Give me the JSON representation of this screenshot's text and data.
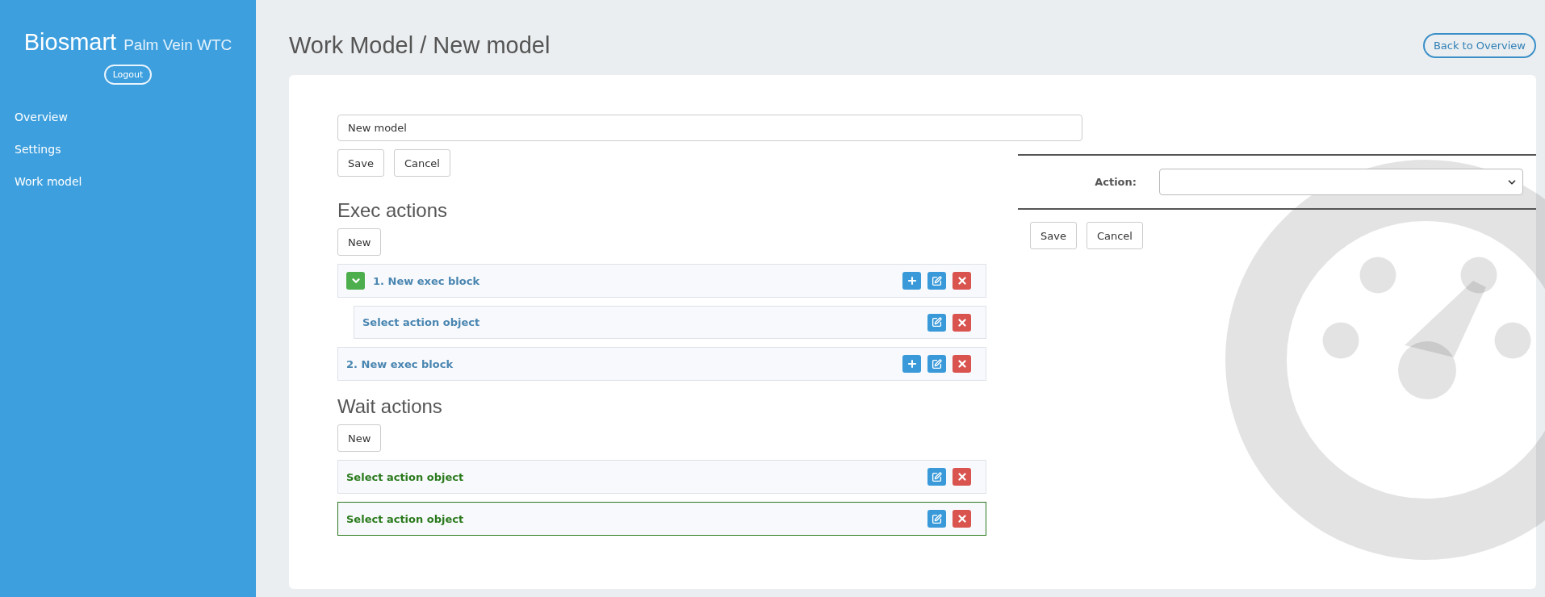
{
  "sidebar": {
    "brand": "Biosmart",
    "subtitle": "Palm Vein WTC",
    "logout": "Logout",
    "items": [
      {
        "label": "Overview"
      },
      {
        "label": "Settings"
      },
      {
        "label": "Work model"
      }
    ]
  },
  "header": {
    "title": "Work Model / New model",
    "back_button": "Back to Overview"
  },
  "model_form": {
    "name_value": "New model",
    "buttons": [
      "Save",
      "Cancel"
    ]
  },
  "exec_actions": {
    "heading": "Exec actions",
    "new_button": "New",
    "blocks": [
      {
        "title": "1. New exec block",
        "expanded": true,
        "children": [
          {
            "title": "Select action object"
          }
        ]
      },
      {
        "title": "2. New exec block"
      }
    ]
  },
  "wait_actions": {
    "heading": "Wait actions",
    "new_button": "New",
    "items": [
      {
        "title": "Select action object",
        "selected": false
      },
      {
        "title": "Select action object",
        "selected": true
      }
    ]
  },
  "action_editor": {
    "label": "Action:",
    "buttons": [
      "Save",
      "Cancel"
    ]
  }
}
